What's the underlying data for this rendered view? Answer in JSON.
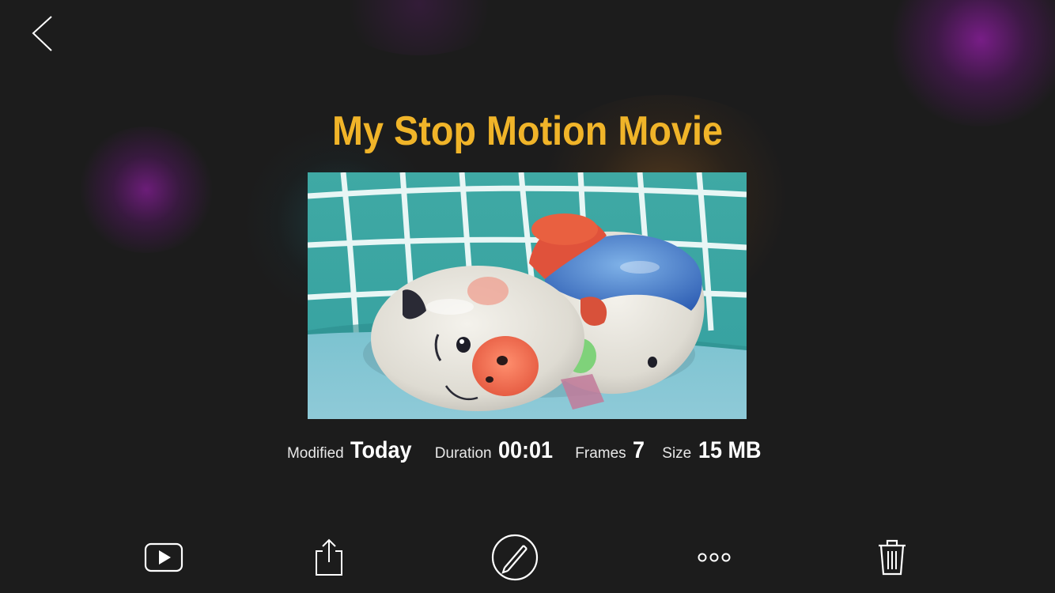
{
  "header": {
    "back_icon": "chevron-left-icon"
  },
  "movie": {
    "title": "My Stop Motion Movie",
    "thumbnail_subject": "ceramic pig figurine on teal checkered pillow"
  },
  "meta": {
    "modified_label": "Modified",
    "modified_value": "Today",
    "duration_label": "Duration",
    "duration_value": "00:01",
    "frames_label": "Frames",
    "frames_value": "7",
    "size_label": "Size",
    "size_value": "15 MB"
  },
  "toolbar": {
    "items": [
      {
        "icon": "play-icon"
      },
      {
        "icon": "share-icon"
      },
      {
        "icon": "edit-pencil-icon"
      },
      {
        "icon": "more-icon"
      },
      {
        "icon": "trash-icon"
      }
    ]
  },
  "colors": {
    "background": "#1c1c1c",
    "title": "#f0b429",
    "text": "#ffffff",
    "glow_purple": "#9b1eaa",
    "glow_orange": "#b46e1e"
  }
}
